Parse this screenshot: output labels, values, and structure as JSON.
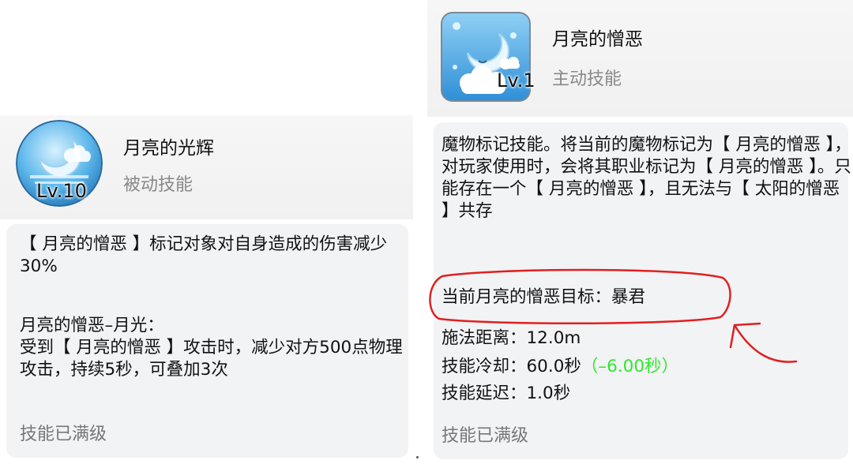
{
  "left": {
    "icon": "crescent-moon-cloud-icon",
    "level": "Lv.10",
    "name": "月亮的光辉",
    "type": "被动技能",
    "desc_1": "【 月亮的憎恶 】标记对象对自身造成的伤害减少30%",
    "desc_2": "月亮的憎恶–月光：",
    "desc_3": "受到【 月亮的憎恶 】攻击时，减少对方500点物理攻击，持续5秒，可叠加3次",
    "status": "技能已满级"
  },
  "right": {
    "icon": "sleeping-moon-cloud-icon",
    "level": "Lv.1",
    "name": "月亮的憎恶",
    "type": "主动技能",
    "desc": "魔物标记技能。将当前的魔物标记为【 月亮的憎恶 】，对玩家使用时，会将其职业标记为【 月亮的憎恶 】。只能存在一个【 月亮的憎恶 】，且无法与【 太阳的憎恶 】共存",
    "target": "当前月亮的憎恶目标：暴君",
    "stat_range": "施法距离：12.0m",
    "stat_cooldown": "技能冷却：60.0秒",
    "stat_cooldown_bonus": "（–6.00秒）",
    "stat_delay": "技能延迟：1.0秒",
    "status": "技能已满级"
  },
  "colors": {
    "highlight": "#e02020",
    "bonus": "#2ee82e",
    "muted": "#888888"
  }
}
